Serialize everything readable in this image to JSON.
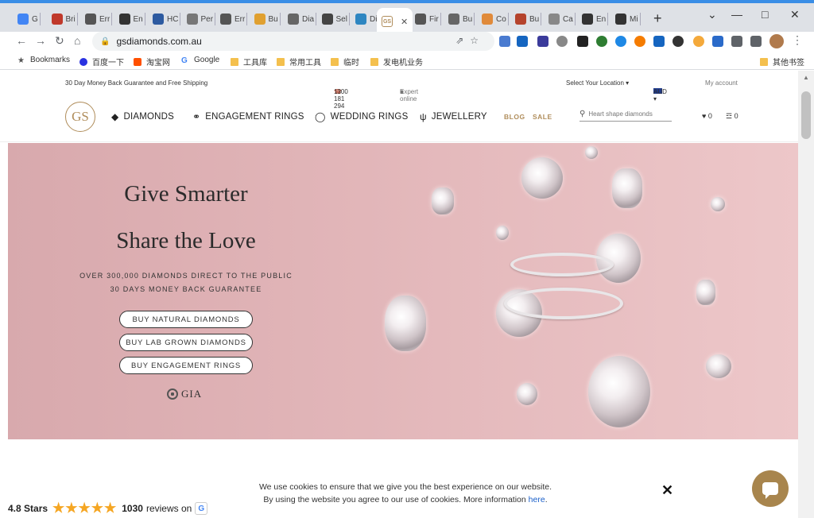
{
  "browser": {
    "tabs": [
      {
        "label": "G",
        "color": "#4285f4"
      },
      {
        "label": "Bri",
        "color": "#c0392b"
      },
      {
        "label": "Err",
        "color": "#555555"
      },
      {
        "label": "En",
        "color": "#333333"
      },
      {
        "label": "HC",
        "color": "#2d5aa0"
      },
      {
        "label": "Per",
        "color": "#777777"
      },
      {
        "label": "Err",
        "color": "#555555"
      },
      {
        "label": "Bu",
        "color": "#e0a030"
      },
      {
        "label": "Dia",
        "color": "#666666"
      },
      {
        "label": "Sel",
        "color": "#444444"
      },
      {
        "label": "Dia",
        "color": "#2e86c1"
      }
    ],
    "active_tab": {
      "label": "GS",
      "close": "✕"
    },
    "tabs_right": [
      {
        "label": "Fir",
        "color": "#555555"
      },
      {
        "label": "Bu",
        "color": "#666666"
      },
      {
        "label": "Co",
        "color": "#e08a3a"
      },
      {
        "label": "Bu",
        "color": "#b5432c"
      },
      {
        "label": "Ca",
        "color": "#888888"
      },
      {
        "label": "En",
        "color": "#333333"
      },
      {
        "label": "Mi",
        "color": "#333333"
      }
    ],
    "new_tab": "+",
    "url": "gsdiamonds.com.au"
  },
  "bookmarks": [
    {
      "label": "Bookmarks"
    },
    {
      "label": "百度一下"
    },
    {
      "label": "淘宝网"
    },
    {
      "label": "Google"
    },
    {
      "label": "工具库"
    },
    {
      "label": "常用工具"
    },
    {
      "label": "临时"
    },
    {
      "label": "发电机业务"
    }
  ],
  "bookmarks_other": "其他书签",
  "topbar": {
    "guarantee": "30 Day Money Back Guarantee and Free Shipping",
    "phone": "1300 181 294",
    "expert": "Expert online",
    "location": "Select Your Location ▾",
    "currency": "AUD ▾",
    "account": "My account"
  },
  "nav": {
    "logo": "GS",
    "diamonds": "DIAMONDS",
    "engagement": "ENGAGEMENT RINGS",
    "wedding": "WEDDING RINGS",
    "jewellery": "JEWELLERY",
    "blog": "BLOG",
    "sale": "SALE",
    "search_placeholder": "Heart shape diamonds",
    "wishlist_count": "0",
    "cart_count": "0"
  },
  "hero": {
    "title1": "Give Smarter",
    "title2": "Share the Love",
    "sub1": "OVER 300,000 DIAMONDS DIRECT TO THE PUBLIC",
    "sub2": "30 DAYS MONEY BACK GUARANTEE",
    "btn_natural": "BUY NATURAL DIAMONDS",
    "btn_lab": "BUY LAB GROWN DIAMONDS",
    "btn_rings": "BUY ENGAGEMENT RINGS",
    "gia": "GIA"
  },
  "cookie": {
    "line1": "We use cookies to ensure that we give you the best experience on our website.",
    "line2": "By using the website you agree to our use of cookies. More information",
    "link": "here",
    "after": ".",
    "close": "✕"
  },
  "rating": {
    "stars_label": "4.8 Stars",
    "stars": "★★★★★",
    "reviews": "1030",
    "reviews_label": "reviews on"
  }
}
